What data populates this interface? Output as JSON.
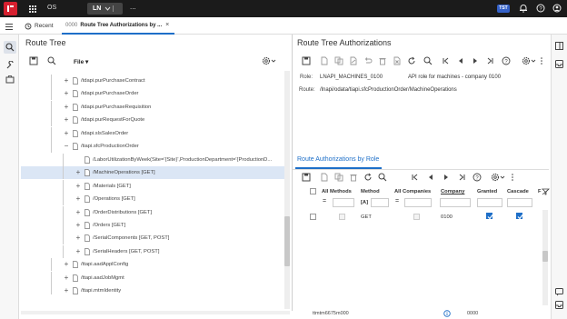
{
  "topbar": {
    "app": "OS",
    "product": "LN",
    "more": "...",
    "user_badge": "TST"
  },
  "tabs": {
    "recent": "Recent",
    "active_session": "0000",
    "active_title": "Route Tree Authorizations by ...",
    "close": "×"
  },
  "left_panel": {
    "title": "Route Tree",
    "file_menu": "File",
    "tree": [
      {
        "label": "/tdapi.purPurchaseContract",
        "level": 1,
        "expander": "+"
      },
      {
        "label": "/tdapi.purPurchaseOrder",
        "level": 1,
        "expander": "+"
      },
      {
        "label": "/tdapi.purPurchaseRequisition",
        "level": 1,
        "expander": "+"
      },
      {
        "label": "/tdapi.purRequestForQuote",
        "level": 1,
        "expander": "+"
      },
      {
        "label": "/tdapi.slsSalesOrder",
        "level": 1,
        "expander": "+"
      },
      {
        "label": "/tiapi.sfcProductionOrder",
        "level": 1,
        "expander": "−"
      },
      {
        "label": "/LaborUtilizationByWeek(Site='{Site}',ProductionDepartment='{ProductionD...",
        "level": 2,
        "expander": ""
      },
      {
        "label": "/MachineOperations [GET]",
        "level": 2,
        "expander": "+",
        "selected": true
      },
      {
        "label": "/Materials [GET]",
        "level": 2,
        "expander": "+"
      },
      {
        "label": "/Operations [GET]",
        "level": 2,
        "expander": "+"
      },
      {
        "label": "/OrderDistributions [GET]",
        "level": 2,
        "expander": "+"
      },
      {
        "label": "/Orders [GET]",
        "level": 2,
        "expander": "+"
      },
      {
        "label": "/SerialComponents [GET, POST]",
        "level": 2,
        "expander": "+"
      },
      {
        "label": "/SerialHeaders [GET, POST]",
        "level": 2,
        "expander": "+"
      },
      {
        "label": "/ttapi.aadApplConfig",
        "level": 1,
        "expander": "+"
      },
      {
        "label": "/ttapi.aadJobMgmt",
        "level": 1,
        "expander": "+"
      },
      {
        "label": "/ttapi.mtmIdentity",
        "level": 1,
        "expander": "+"
      }
    ]
  },
  "right_panel": {
    "title": "Route Tree Authorizations",
    "role_label": "Role:",
    "role_value": "LNAPI_MACHINES_0100",
    "role_desc": "API role for machines - company 0100",
    "route_label": "Route:",
    "route_value": "/lnapi/odata/tiapi.sfcProductionOrder/MachineOperations",
    "subtab": "Route Authorizations by Role",
    "grid": {
      "headers": [
        "All Methods",
        "Method",
        "All Companies",
        "Company",
        "Granted",
        "Cascade",
        "F"
      ],
      "filter_eq": "=",
      "filter_method_hint": "[A]",
      "rows": [
        {
          "method": "GET",
          "company": "0100",
          "granted": true,
          "cascade": true
        }
      ]
    }
  },
  "statusbar": {
    "session": "ttmtm6675m000",
    "company": "0000"
  },
  "colors": {
    "accent": "#1e6fc8",
    "brand": "#d6202f",
    "topbar": "#1b1b1b",
    "selection": "#dbe6f5"
  }
}
